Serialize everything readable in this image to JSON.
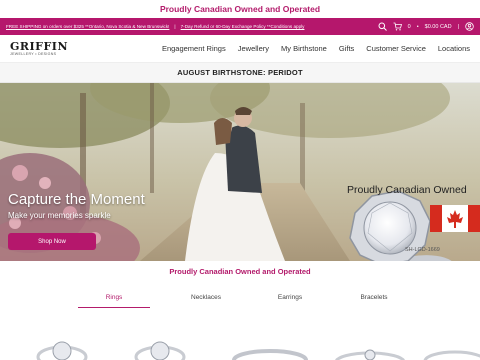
{
  "top_banner": {
    "text": "Proudly Canadian Owned and Operated"
  },
  "promo_bar": {
    "promo1": "FREE SHIPPING on orders over $325 **Ontario, Nova Scotia & New Brunswick!",
    "promo2": "7-Day Refund or 60-Day Exchange Policy **Conditions apply",
    "cart_count": "0",
    "cart_total": "$0.00 CAD",
    "icons": [
      "search-icon",
      "cart-icon",
      "account-icon"
    ]
  },
  "header": {
    "logo_main": "GRIFFIN",
    "logo_sub": "JEWELLERY • DESIGNS",
    "nav": [
      "Engagement Rings",
      "Jewellery",
      "My Birthstone",
      "Gifts",
      "Customer Service",
      "Locations"
    ]
  },
  "birthstone_bar": {
    "text": "AUGUST BIRTHSTONE: PERIDOT"
  },
  "hero": {
    "title": "Capture the Moment",
    "subtitle": "Make your memories sparkle",
    "button": "Shop Now",
    "canada_text": "Proudly Canadian Owned",
    "sku": "SH-LGD-1669"
  },
  "tagline": {
    "text": "Proudly Canadian Owned and Operated"
  },
  "tabs": {
    "items": [
      "Rings",
      "Necklaces",
      "Earrings",
      "Bracelets"
    ],
    "active": "Rings"
  },
  "colors": {
    "brand": "#b5176c",
    "brand_text": "#b31b6b",
    "flag_red": "#d52b1e"
  }
}
